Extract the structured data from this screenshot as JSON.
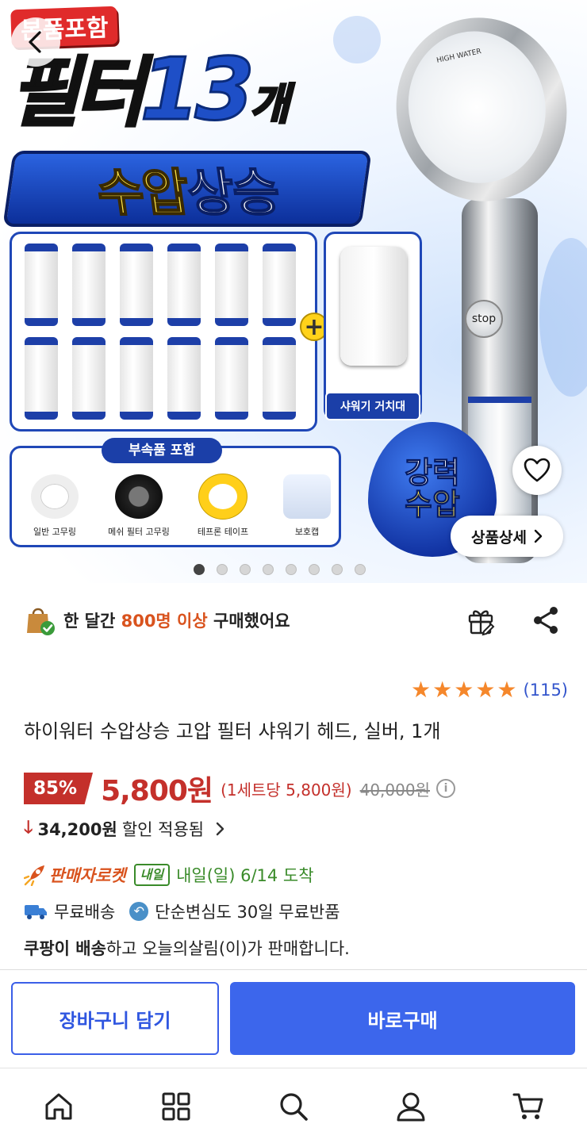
{
  "hero": {
    "badge": "본품포함",
    "title_prefix": "필터",
    "title_number": "13",
    "title_unit": "개",
    "pressure_yellow": "수압",
    "pressure_white": "상승",
    "holder_label": "샤워기 거치대",
    "accessories_title": "부속품 포함",
    "accessories": [
      "일반 고무링",
      "메쉬 필터 고무링",
      "테프론 테이프",
      "보호캡"
    ],
    "drop_line1": "강력",
    "drop_line2": "수압",
    "brand_text": "HIGH WATER",
    "stop_label": "stop",
    "detail_button": "상품상세",
    "slide_count": 8,
    "active_slide": 1
  },
  "purchase": {
    "prefix": "한 달간 ",
    "highlight": "800명 이상",
    "suffix": " 구매했어요"
  },
  "rating": {
    "stars": 5,
    "count": "(115)"
  },
  "product": {
    "title": "하이워터 수압상승 고압 필터 샤워기 헤드, 실버, 1개"
  },
  "price": {
    "discount": "85%",
    "sale": "5,800원",
    "unit": "(1세트당 5,800원)",
    "original": "40,000원",
    "saving_amount": "34,200원",
    "saving_text": "할인 적용됨"
  },
  "delivery": {
    "rocket_label": "판매자로켓",
    "tomorrow_badge": "내일",
    "arrival": "내일(일) 6/14 도착",
    "free_shipping": "무료배송",
    "free_return": "단순변심도 30일 무료반품",
    "seller_bold": "쿠팡이 배송",
    "seller_rest": "하고 오늘의살림(이)가 판매합니다."
  },
  "actions": {
    "cart": "장바구니 담기",
    "buy": "바로구매"
  },
  "colors": {
    "accent_blue": "#3c66ec",
    "sale_red": "#c4302b",
    "rocket_orange": "#d9531e",
    "delivery_green": "#3a8b2a",
    "star_orange": "#f5872b"
  },
  "nav": [
    "home-icon",
    "category-icon",
    "search-icon",
    "user-icon",
    "cart-icon"
  ]
}
